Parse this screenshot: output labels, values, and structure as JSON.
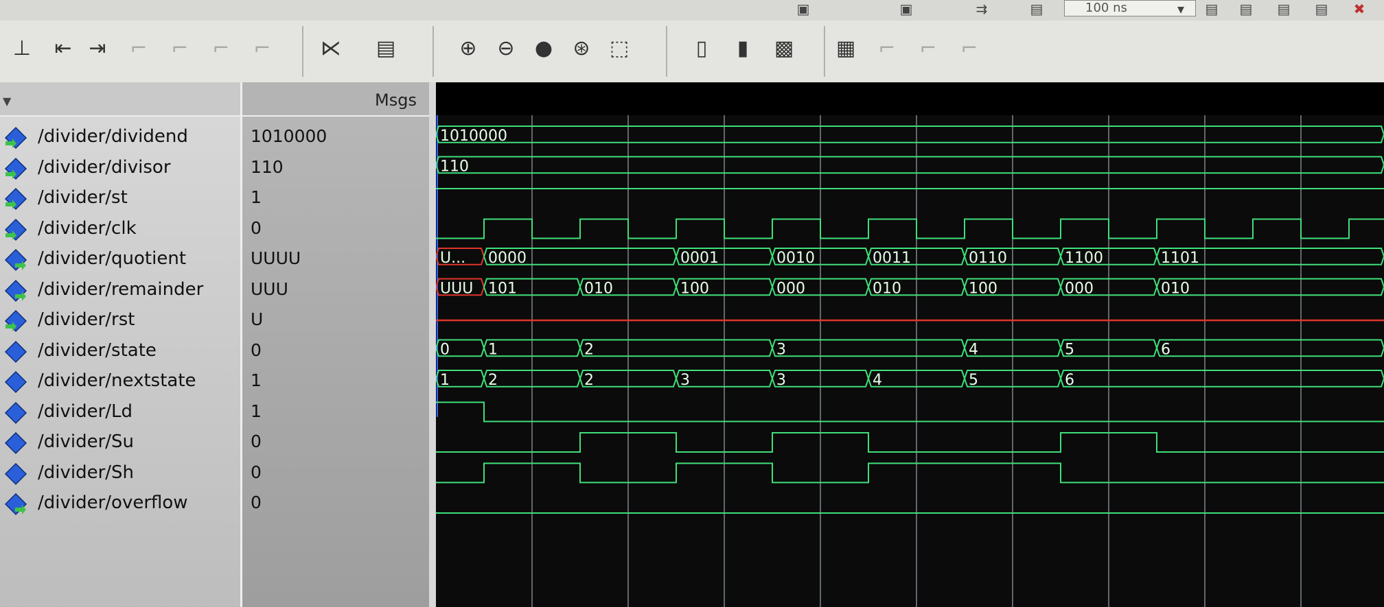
{
  "toolbar": {
    "zoom_label": "100 ns",
    "buttons": [
      {
        "name": "insert-cursor-icon",
        "glyph": "⊥"
      },
      {
        "name": "find-previous-edge-icon",
        "glyph": "⇤"
      },
      {
        "name": "find-next-edge-icon",
        "glyph": "⇥"
      },
      {
        "name": "step-edge-1-icon",
        "glyph": "⌐"
      },
      {
        "name": "step-edge-2-icon",
        "glyph": "⌐"
      },
      {
        "name": "step-edge-3-icon",
        "glyph": "⌐"
      },
      {
        "name": "step-edge-4-icon",
        "glyph": "⌐"
      },
      {
        "name": "split-view-icon",
        "glyph": "⋉"
      },
      {
        "name": "wave-settings-icon",
        "glyph": "▤"
      },
      {
        "name": "zoom-in-icon",
        "glyph": "⊕"
      },
      {
        "name": "zoom-out-icon",
        "glyph": "⊖"
      },
      {
        "name": "zoom-full-icon",
        "glyph": "●"
      },
      {
        "name": "zoom-cursor-icon",
        "glyph": "⊛"
      },
      {
        "name": "zoom-area-icon",
        "glyph": "⬚"
      },
      {
        "name": "cursor-mode-1-icon",
        "glyph": "▯"
      },
      {
        "name": "cursor-mode-2-icon",
        "glyph": "▮"
      },
      {
        "name": "cursor-mode-3-icon",
        "glyph": "▩"
      },
      {
        "name": "edge-mode-1-icon",
        "glyph": "▦"
      },
      {
        "name": "edge-mode-2-icon",
        "glyph": "⌐"
      },
      {
        "name": "edge-mode-3-icon",
        "glyph": "⌐"
      },
      {
        "name": "edge-mode-4-icon",
        "glyph": "⌐"
      }
    ]
  },
  "header": {
    "msgs_label": "Msgs"
  },
  "signals": [
    {
      "name": "/divider/dividend",
      "value": "1010000",
      "kind": "input"
    },
    {
      "name": "/divider/divisor",
      "value": "110",
      "kind": "input"
    },
    {
      "name": "/divider/st",
      "value": "1",
      "kind": "input"
    },
    {
      "name": "/divider/clk",
      "value": "0",
      "kind": "input"
    },
    {
      "name": "/divider/quotient",
      "value": "UUUU",
      "kind": "output"
    },
    {
      "name": "/divider/remainder",
      "value": "UUU",
      "kind": "output"
    },
    {
      "name": "/divider/rst",
      "value": "U",
      "kind": "input"
    },
    {
      "name": "/divider/state",
      "value": "0",
      "kind": "internal"
    },
    {
      "name": "/divider/nextstate",
      "value": "1",
      "kind": "internal"
    },
    {
      "name": "/divider/Ld",
      "value": "1",
      "kind": "internal"
    },
    {
      "name": "/divider/Su",
      "value": "0",
      "kind": "internal"
    },
    {
      "name": "/divider/Sh",
      "value": "0",
      "kind": "internal"
    },
    {
      "name": "/divider/overflow",
      "value": "0",
      "kind": "output"
    }
  ],
  "waves": {
    "bus_labels": {
      "dividend": [
        "1010000"
      ],
      "divisor": [
        "110"
      ],
      "quotient": [
        "U...",
        "0000",
        "0001",
        "0010",
        "0011",
        "0110",
        "1100",
        "1101"
      ],
      "remainder": [
        "UUU",
        "101",
        "010",
        "100",
        "000",
        "010",
        "100",
        "000",
        "010"
      ],
      "state": [
        "0",
        "1",
        "2",
        "3",
        "4",
        "5",
        "6"
      ],
      "nextstate": [
        "1",
        "2",
        "2",
        "3",
        "3",
        "4",
        "5",
        "6"
      ]
    }
  },
  "colors": {
    "wave_green": "#3fe07a",
    "undefined_red": "#e0352b",
    "grid": "#9aa7b0",
    "background": "#0b0b0b"
  }
}
